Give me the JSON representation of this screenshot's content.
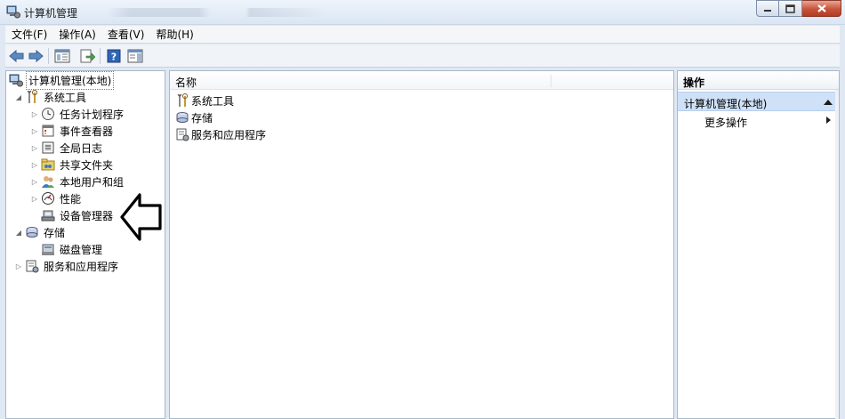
{
  "window": {
    "title": "计算机管理",
    "blurred_watermark": "http://                    .com"
  },
  "menu": {
    "items": [
      "文件(F)",
      "操作(A)",
      "查看(V)",
      "帮助(H)"
    ]
  },
  "toolbar": {
    "buttons": [
      "back-arrow-icon",
      "forward-arrow-icon",
      "console-tree-icon",
      "export-list-icon",
      "help-icon",
      "show-hide-action-pane-icon"
    ]
  },
  "tree": {
    "root": "计算机管理(本地)",
    "system_tools": "系统工具",
    "task_scheduler": "任务计划程序",
    "event_viewer": "事件查看器",
    "global_log": "全局日志",
    "shared_folders": "共享文件夹",
    "local_users": "本地用户和组",
    "performance": "性能",
    "device_manager": "设备管理器",
    "storage": "存储",
    "disk_management": "磁盘管理",
    "services_apps": "服务和应用程序"
  },
  "list": {
    "column_name": "名称",
    "items": [
      "系统工具",
      "存储",
      "服务和应用程序"
    ]
  },
  "actions": {
    "header": "操作",
    "section": "计算机管理(本地)",
    "more_actions": "更多操作"
  },
  "colors": {
    "selection": "#cfe1f7",
    "close_button": "#c7533a",
    "pane_border": "#a9b8cb"
  }
}
